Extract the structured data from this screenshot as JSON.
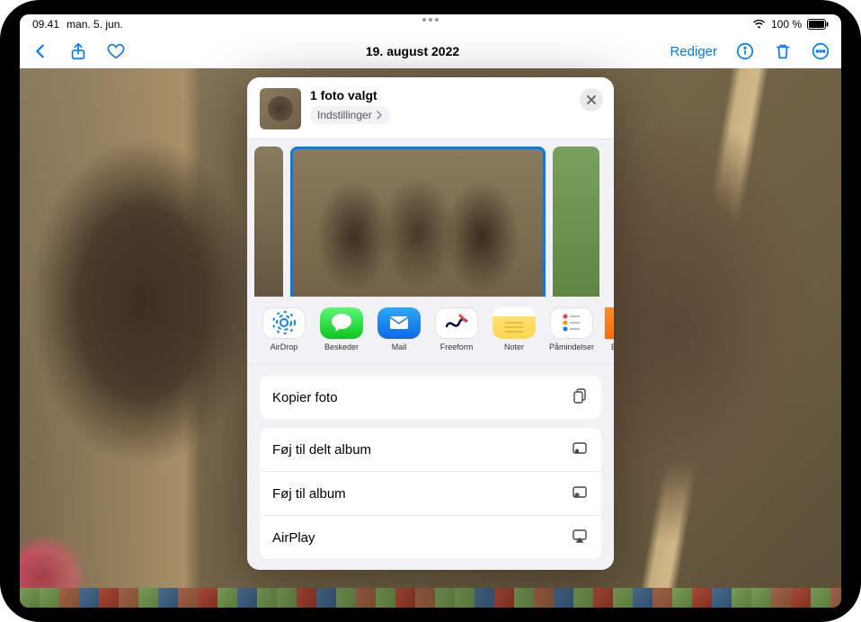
{
  "status": {
    "time": "09.41",
    "date": "man. 5. jun.",
    "battery": "100 %"
  },
  "nav": {
    "title": "19. august 2022",
    "edit": "Rediger"
  },
  "share": {
    "title": "1 foto valgt",
    "options": "Indstillinger",
    "apps": [
      {
        "label": "AirDrop"
      },
      {
        "label": "Beskeder"
      },
      {
        "label": "Mail"
      },
      {
        "label": "Freeform"
      },
      {
        "label": "Noter"
      },
      {
        "label": "Påmindelser"
      },
      {
        "label": "B"
      }
    ],
    "actions_group1": [
      {
        "label": "Kopier foto"
      }
    ],
    "actions_group2": [
      {
        "label": "Føj til delt album"
      },
      {
        "label": "Føj til album"
      },
      {
        "label": "AirPlay"
      }
    ]
  }
}
